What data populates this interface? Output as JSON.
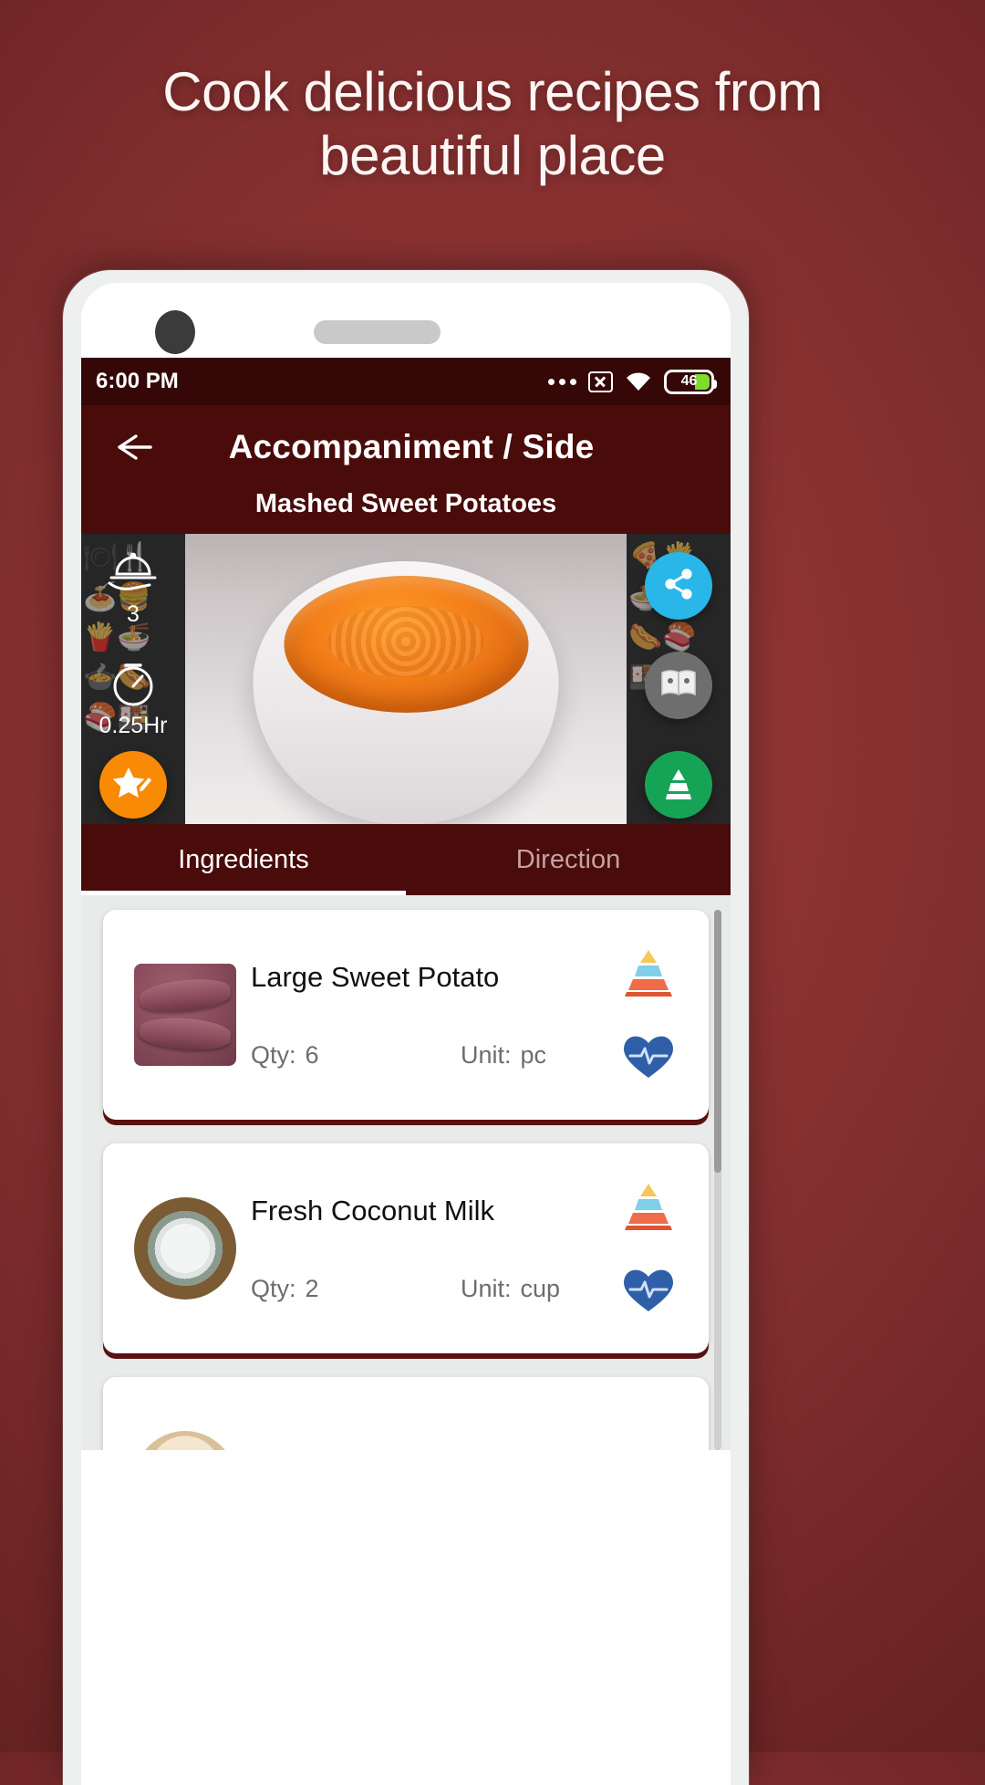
{
  "promo": {
    "line1": "Cook delicious recipes from",
    "line2": "beautiful place"
  },
  "status_bar": {
    "time": "6:00 PM",
    "icons": [
      "more-dots-icon",
      "no-sim-icon",
      "wifi-icon",
      "battery-icon"
    ],
    "battery_level": "46"
  },
  "app_bar": {
    "back_label": "←",
    "title": "Accompaniment / Side",
    "recipe_name": "Mashed Sweet Potatoes",
    "bg_color": "#4a0b0b"
  },
  "hero": {
    "servings_label": "3",
    "servings_icon": "serving-dome-icon",
    "time_label": "0.25Hr",
    "time_icon": "timer-icon",
    "favorite_icon": "star-edit-icon",
    "share_icon": "share-icon",
    "nutrition_icon": "book-icon",
    "pyramid_icon": "food-pyramid-icon",
    "favorite_color": "#f98a06",
    "share_color": "#29b6e8",
    "book_color": "#6e6e6e",
    "pyramid_color": "#17a356"
  },
  "tabs": [
    {
      "label": "Ingredients",
      "active": true
    },
    {
      "label": "Direction",
      "active": false
    }
  ],
  "ingredients": {
    "qty_label": "Qty:",
    "unit_label": "Unit:",
    "items": [
      {
        "name": "Large Sweet Potato",
        "qty": "6",
        "unit": "pc",
        "thumb": "potato"
      },
      {
        "name": "Fresh Coconut Milk",
        "qty": "2",
        "unit": "cup",
        "thumb": "coconut"
      },
      {
        "name": "",
        "qty": "",
        "unit": "",
        "thumb": "partial"
      }
    ],
    "row_icons": [
      "food-pyramid-icon",
      "nutrition-heart-icon"
    ]
  },
  "colors": {
    "background": "#8d3333",
    "app_bar": "#4a0b0b",
    "status_bar": "#350707",
    "card_shadow": "#5a1111",
    "accent_orange": "#f98a06"
  }
}
